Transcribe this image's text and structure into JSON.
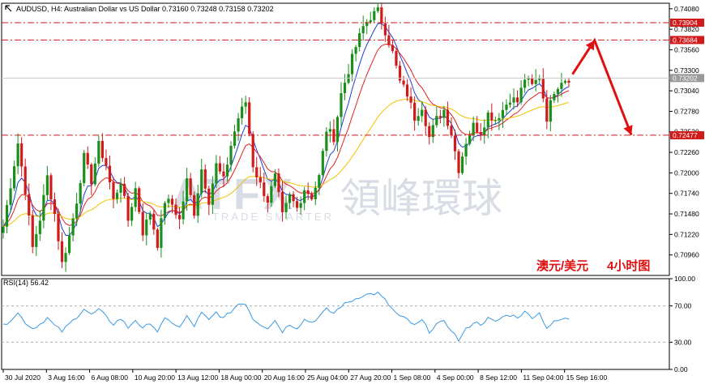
{
  "header": {
    "title_line": "AUDUSD, H4:  Australian Dollar vs US Dollar  0.73160 0.73248 0.73158 0.73202"
  },
  "watermark": {
    "brand": "ATFX",
    "chinese": "領峰環球",
    "tagline": "TRADE SMARTER"
  },
  "annotation": {
    "pair_cn": "澳元/美元",
    "timeframe_cn": "4小时图"
  },
  "colors": {
    "bull": "#1a8f1a",
    "bear": "#d11a1a",
    "ma_fast": "#1f3fd6",
    "ma_mid": "#e02020",
    "ma_slow": "#f2c200",
    "rsi": "#3a9ae0",
    "level_line": "#d11a1a",
    "arrow": "#e01010",
    "price_badge": "#d11a1a",
    "current_badge": "#9a9a9a"
  },
  "chart_data": [
    {
      "type": "candlestick",
      "title": "AUDUSD, H4:  Australian Dollar vs US Dollar",
      "ohlc_last": {
        "open": 0.7316,
        "high": 0.73248,
        "low": 0.73158,
        "close": 0.73202
      },
      "x_ticks": [
        "30 Jul 2020",
        "3 Aug 16:00",
        "6 Aug 08:00",
        "10 Aug 20:00",
        "13 Aug 12:00",
        "18 Aug 00:00",
        "20 Aug 16:00",
        "25 Aug 04:00",
        "27 Aug 20:00",
        "1 Sep 08:00",
        "4 Sep 00:00",
        "8 Sep 12:00",
        "11 Sep 04:00",
        "15 Sep 16:00"
      ],
      "y_ticks": [
        "0.74080",
        "0.73820",
        "0.73560",
        "0.73300",
        "0.73040",
        "0.72780",
        "0.72520",
        "0.72260",
        "0.72000",
        "0.71740",
        "0.71480",
        "0.71220",
        "0.70960"
      ],
      "ylim": [
        0.707,
        0.7415
      ],
      "levels": [
        {
          "value": 0.73904,
          "label": "0.73904"
        },
        {
          "value": 0.73684,
          "label": "0.73684"
        },
        {
          "value": 0.72477,
          "label": "0.72477"
        }
      ],
      "current_price": {
        "value": 0.73202,
        "label": "0.73202"
      },
      "close_path": [
        [
          0,
          0.7132
        ],
        [
          2,
          0.7185
        ],
        [
          4,
          0.7238
        ],
        [
          6,
          0.7178
        ],
        [
          8,
          0.7105
        ],
        [
          10,
          0.7142
        ],
        [
          12,
          0.7195
        ],
        [
          14,
          0.7148
        ],
        [
          16,
          0.7085
        ],
        [
          18,
          0.712
        ],
        [
          20,
          0.7165
        ],
        [
          22,
          0.722
        ],
        [
          24,
          0.719
        ],
        [
          26,
          0.7235
        ],
        [
          28,
          0.721
        ],
        [
          30,
          0.7165
        ],
        [
          32,
          0.719
        ],
        [
          34,
          0.714
        ],
        [
          36,
          0.718
        ],
        [
          38,
          0.7125
        ],
        [
          40,
          0.715
        ],
        [
          42,
          0.711
        ],
        [
          44,
          0.7165
        ],
        [
          46,
          0.716
        ],
        [
          48,
          0.714
        ],
        [
          50,
          0.719
        ],
        [
          52,
          0.715
        ],
        [
          54,
          0.7205
        ],
        [
          56,
          0.7165
        ],
        [
          58,
          0.721
        ],
        [
          60,
          0.719
        ],
        [
          62,
          0.7235
        ],
        [
          64,
          0.727
        ],
        [
          66,
          0.729
        ],
        [
          68,
          0.721
        ],
        [
          70,
          0.7185
        ],
        [
          72,
          0.7165
        ],
        [
          74,
          0.7195
        ],
        [
          76,
          0.7145
        ],
        [
          78,
          0.717
        ],
        [
          80,
          0.7155
        ],
        [
          82,
          0.718
        ],
        [
          84,
          0.717
        ],
        [
          86,
          0.7195
        ],
        [
          88,
          0.7255
        ],
        [
          90,
          0.7245
        ],
        [
          92,
          0.73
        ],
        [
          94,
          0.733
        ],
        [
          96,
          0.736
        ],
        [
          98,
          0.7385
        ],
        [
          100,
          0.7398
        ],
        [
          102,
          0.7405
        ],
        [
          104,
          0.738
        ],
        [
          106,
          0.7352
        ],
        [
          108,
          0.7315
        ],
        [
          110,
          0.73
        ],
        [
          112,
          0.727
        ],
        [
          114,
          0.7285
        ],
        [
          116,
          0.7245
        ],
        [
          118,
          0.7268
        ],
        [
          120,
          0.728
        ],
        [
          122,
          0.725
        ],
        [
          124,
          0.7205
        ],
        [
          126,
          0.724
        ],
        [
          128,
          0.726
        ],
        [
          130,
          0.7252
        ],
        [
          132,
          0.7275
        ],
        [
          134,
          0.7268
        ],
        [
          136,
          0.728
        ],
        [
          138,
          0.7295
        ],
        [
          140,
          0.729
        ],
        [
          142,
          0.732
        ],
        [
          144,
          0.731
        ],
        [
          146,
          0.7322
        ],
        [
          148,
          0.727
        ],
        [
          150,
          0.7305
        ],
        [
          152,
          0.7318
        ],
        [
          154,
          0.732
        ]
      ],
      "forecast_path": [
        [
          155,
          0.7325
        ],
        [
          161,
          0.7368
        ],
        [
          171,
          0.7248
        ]
      ]
    },
    {
      "type": "line",
      "title": "RSI(14) 56.42",
      "y_ticks": [
        "100.00",
        "70.00",
        "30.00",
        "0.00"
      ],
      "ylim": [
        0,
        100
      ],
      "guides": [
        70,
        30
      ],
      "series": [
        {
          "name": "RSI(14)",
          "values": [
            [
              0,
              48
            ],
            [
              2,
              55
            ],
            [
              4,
              62
            ],
            [
              6,
              52
            ],
            [
              8,
              45
            ],
            [
              10,
              50
            ],
            [
              12,
              57
            ],
            [
              14,
              48
            ],
            [
              16,
              42
            ],
            [
              18,
              50
            ],
            [
              20,
              58
            ],
            [
              22,
              67
            ],
            [
              24,
              60
            ],
            [
              26,
              66
            ],
            [
              28,
              58
            ],
            [
              30,
              50
            ],
            [
              32,
              56
            ],
            [
              34,
              46
            ],
            [
              36,
              55
            ],
            [
              38,
              44
            ],
            [
              40,
              52
            ],
            [
              42,
              42
            ],
            [
              44,
              55
            ],
            [
              46,
              52
            ],
            [
              48,
              46
            ],
            [
              50,
              58
            ],
            [
              52,
              48
            ],
            [
              54,
              62
            ],
            [
              56,
              54
            ],
            [
              58,
              63
            ],
            [
              60,
              56
            ],
            [
              62,
              64
            ],
            [
              64,
              72
            ],
            [
              66,
              73
            ],
            [
              68,
              56
            ],
            [
              70,
              50
            ],
            [
              72,
              46
            ],
            [
              74,
              54
            ],
            [
              76,
              42
            ],
            [
              78,
              50
            ],
            [
              80,
              46
            ],
            [
              82,
              55
            ],
            [
              84,
              52
            ],
            [
              86,
              58
            ],
            [
              88,
              66
            ],
            [
              90,
              62
            ],
            [
              92,
              70
            ],
            [
              94,
              74
            ],
            [
              96,
              78
            ],
            [
              98,
              82
            ],
            [
              100,
              83
            ],
            [
              102,
              84
            ],
            [
              104,
              76
            ],
            [
              106,
              66
            ],
            [
              108,
              58
            ],
            [
              110,
              55
            ],
            [
              112,
              48
            ],
            [
              114,
              54
            ],
            [
              116,
              42
            ],
            [
              118,
              50
            ],
            [
              120,
              52
            ],
            [
              122,
              44
            ],
            [
              124,
              32
            ],
            [
              126,
              44
            ],
            [
              128,
              52
            ],
            [
              130,
              50
            ],
            [
              132,
              56
            ],
            [
              134,
              52
            ],
            [
              136,
              58
            ],
            [
              138,
              60
            ],
            [
              140,
              58
            ],
            [
              142,
              63
            ],
            [
              144,
              58
            ],
            [
              146,
              62
            ],
            [
              148,
              46
            ],
            [
              150,
              52
            ],
            [
              152,
              55
            ],
            [
              154,
              56
            ]
          ]
        }
      ]
    }
  ]
}
